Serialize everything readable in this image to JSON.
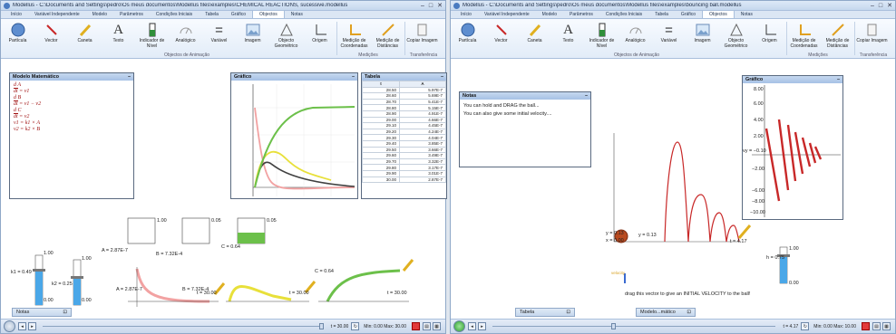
{
  "left": {
    "title": "Modellus - C:\\Documents and Settings\\pedro\\Os meus documentos\\Modellus files\\examples\\CHEMICAL REACTIONS, sucessive.modellus",
    "tabs": [
      "Início",
      "Variável Independente",
      "Modelo",
      "Parâmetros",
      "Condições Iniciais",
      "Tabela",
      "Gráfico",
      "Objectos",
      "Notas"
    ],
    "active_tab": "Objectos",
    "ribbon": [
      {
        "label": "Partícula",
        "icon": "sphere-icon"
      },
      {
        "label": "Vector",
        "icon": "vector-icon"
      },
      {
        "label": "Caneta",
        "icon": "pen-icon"
      },
      {
        "label": "Texto",
        "icon": "text-icon"
      },
      {
        "label": "Indicador de Nível",
        "icon": "level-icon"
      },
      {
        "label": "Analógico",
        "icon": "gauge-icon"
      },
      {
        "label": "Variável",
        "icon": "variable-icon"
      },
      {
        "label": "Imagem",
        "icon": "image-icon"
      },
      {
        "label": "Objecto Geométrico",
        "icon": "geometry-icon"
      },
      {
        "label": "Origem",
        "icon": "origin-icon"
      },
      {
        "label": "Medição de Coordenadas",
        "icon": "measure-coord-icon"
      },
      {
        "label": "Medição de Distâncias",
        "icon": "measure-dist-icon"
      },
      {
        "label": "Copiar Imagem",
        "icon": "copy-icon"
      }
    ],
    "groups": {
      "anim": "Objectos de Animação",
      "measure": "Medições",
      "transfer": "Transferência"
    },
    "model_panel": {
      "title": "Modelo Matemático",
      "eq1_num": "d A",
      "eq1_den": "dt",
      "eq1_rhs": "= v1",
      "eq2_num": "d B",
      "eq2_den": "dt",
      "eq2_rhs": "= v1 − v2",
      "eq3_num": "d C",
      "eq3_den": "dt",
      "eq3_rhs": "= v2",
      "eq4": "v1 = k1 × A",
      "eq5": "v2 = k2 × B"
    },
    "graph_panel": {
      "title": "Gráfico"
    },
    "table_panel": {
      "title": "Tabela",
      "headers": [
        "t",
        "A"
      ],
      "rows": [
        [
          "28.50",
          "5.97E-7"
        ],
        [
          "28.60",
          "5.69E-7"
        ],
        [
          "28.70",
          "5.41E-7"
        ],
        [
          "28.80",
          "5.15E-7"
        ],
        [
          "28.90",
          "4.91E-7"
        ],
        [
          "29.00",
          "4.66E-7"
        ],
        [
          "29.10",
          "4.45E-7"
        ],
        [
          "29.20",
          "4.24E-7"
        ],
        [
          "29.30",
          "4.04E-7"
        ],
        [
          "29.40",
          "3.85E-7"
        ],
        [
          "29.50",
          "3.66E-7"
        ],
        [
          "29.60",
          "3.49E-7"
        ],
        [
          "29.70",
          "3.32E-7"
        ],
        [
          "29.80",
          "3.17E-7"
        ],
        [
          "29.90",
          "3.01E-7"
        ],
        [
          "30.00",
          "2.87E-7"
        ]
      ]
    },
    "labels": {
      "k1": "k1 = 0.49",
      "k2": "k2 = 0.25",
      "A": "A = 2.87E-7",
      "B": "B = 7.32E-4",
      "C": "C = 0.64",
      "A2": "A = 2.87E-7",
      "B2": "B = 7.32E-4",
      "C2": "C = 0.64",
      "t1": "t = 30.00",
      "t2": "t = 30.00",
      "t3": "t = 30.00",
      "s100a": "1.00",
      "s000a": "0.00",
      "s100b": "1.00",
      "s000b": "0.00",
      "b05a": "0.05",
      "b05b": "0.05",
      "b100": "1.00",
      "b000": "0.00"
    },
    "notes_tab": "Notas",
    "status": {
      "t": "t = 30.00",
      "range": "Min: 0.00 Max: 30.00"
    }
  },
  "right": {
    "title": "Modellus - C:\\Documents and Settings\\pedro\\Os meus documentos\\Modellus files\\examples\\bouncing ball.modellus",
    "tabs": [
      "Início",
      "Variável Independente",
      "Modelo",
      "Parâmetros",
      "Condições Iniciais",
      "Tabela",
      "Gráfico",
      "Objectos",
      "Notas"
    ],
    "active_tab": "Objectos",
    "notes_panel": {
      "title": "Notas",
      "line1": "You can hold and DRAG the ball...",
      "line2": "You can also give some initial velocity...."
    },
    "graph_panel": {
      "title": "Gráfico",
      "vy": "vy = −0.10"
    },
    "labels": {
      "y1": "y = 0.13",
      "y2": "y = 0.13",
      "x0": "x = 0.00",
      "t": "t = 4.17",
      "h": "h = 0.75",
      "h1": "1.00",
      "h0": "0.00",
      "vel": "velocity",
      "hint": "drag this vector to give an INITIAL VELOCITY to the ball!",
      "g8": "8.00",
      "g6": "6.00",
      "g4": "4.00",
      "g2": "2.00",
      "gm2": "−2.00",
      "gm6": "−6.00",
      "gm8": "−8.00",
      "gm10": "−10.00"
    },
    "tab_tabela": "Tabela",
    "tab_modelo": "Modelo...mático",
    "status": {
      "t": "t = 4.17",
      "range": "Min: 0.00 Max: 10.00"
    }
  },
  "colors": {
    "red": "#c82828",
    "green": "#6cc04a",
    "yellow": "#e8e03a",
    "pink": "#f2a2a2",
    "dark": "#404040"
  }
}
